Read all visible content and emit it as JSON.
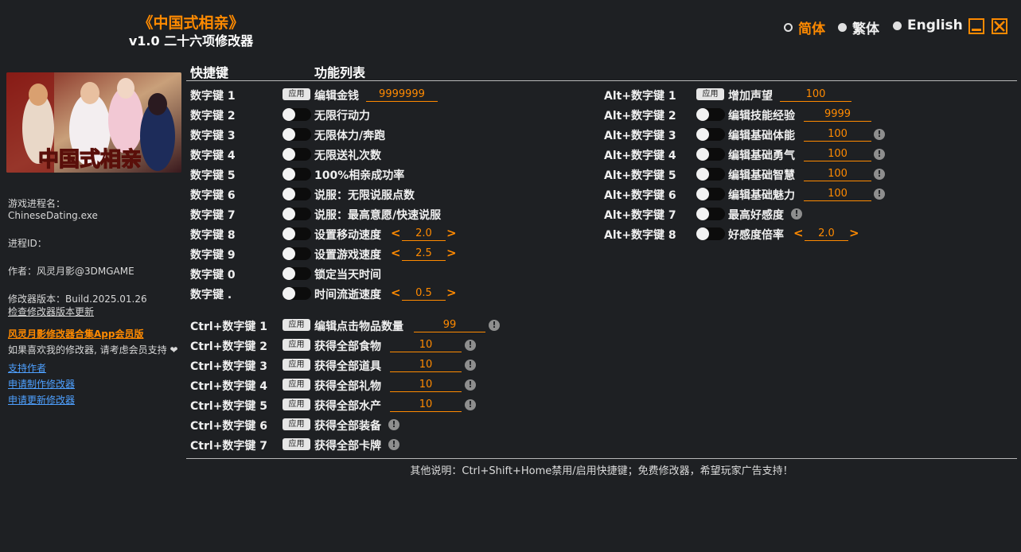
{
  "header": {
    "title": "《中国式相亲》",
    "subtitle": "v1.0 二十六项修改器",
    "languages": [
      "简体",
      "繁体",
      "English"
    ],
    "active_language": "简体"
  },
  "sidebar": {
    "cover_title": "中国式相亲",
    "process_label": "游戏进程名：",
    "process_name": "ChineseDating.exe",
    "pid_label": "进程ID：",
    "author": "作者：风灵月影@3DMGAME",
    "version": "修改器版本：Build.2025.01.26",
    "check_update": "检查修改器版本更新",
    "app_link": "风灵月影修改器合集App会员版",
    "support_text": "如果喜欢我的修改器, 请考虑会员支持",
    "links": [
      "支持作者",
      "申请制作修改器",
      "申请更新修改器"
    ]
  },
  "columns": {
    "hotkey": "快捷键",
    "features": "功能列表"
  },
  "apply_label": "应用",
  "left_rows": [
    {
      "key": "数字键 1",
      "label": "编辑金钱",
      "value": "9999999"
    },
    {
      "key": "数字键 2",
      "label": "无限行动力"
    },
    {
      "key": "数字键 3",
      "label": "无限体力/奔跑"
    },
    {
      "key": "数字键 4",
      "label": "无限送礼次数"
    },
    {
      "key": "数字键 5",
      "label": "100%相亲成功率"
    },
    {
      "key": "数字键 6",
      "label": "说服：无限说服点数"
    },
    {
      "key": "数字键 7",
      "label": "说服：最高意愿/快速说服"
    },
    {
      "key": "数字键 8",
      "label": "设置移动速度",
      "value": "2.0"
    },
    {
      "key": "数字键 9",
      "label": "设置游戏速度",
      "value": "2.5"
    },
    {
      "key": "数字键 0",
      "label": "锁定当天时间"
    },
    {
      "key": "数字键 .",
      "label": "时间流逝速度",
      "value": "0.5"
    }
  ],
  "ctrl_rows": [
    {
      "key": "Ctrl+数字键 1",
      "label": "编辑点击物品数量",
      "value": "99"
    },
    {
      "key": "Ctrl+数字键 2",
      "label": "获得全部食物",
      "value": "10"
    },
    {
      "key": "Ctrl+数字键 3",
      "label": "获得全部道具",
      "value": "10"
    },
    {
      "key": "Ctrl+数字键 4",
      "label": "获得全部礼物",
      "value": "10"
    },
    {
      "key": "Ctrl+数字键 5",
      "label": "获得全部水产",
      "value": "10"
    },
    {
      "key": "Ctrl+数字键 6",
      "label": "获得全部装备"
    },
    {
      "key": "Ctrl+数字键 7",
      "label": "获得全部卡牌"
    }
  ],
  "alt_rows": [
    {
      "key": "Alt+数字键 1",
      "label": "增加声望",
      "value": "100"
    },
    {
      "key": "Alt+数字键 2",
      "label": "编辑技能经验",
      "value": "9999"
    },
    {
      "key": "Alt+数字键 3",
      "label": "编辑基础体能",
      "value": "100"
    },
    {
      "key": "Alt+数字键 4",
      "label": "编辑基础勇气",
      "value": "100"
    },
    {
      "key": "Alt+数字键 5",
      "label": "编辑基础智慧",
      "value": "100"
    },
    {
      "key": "Alt+数字键 6",
      "label": "编辑基础魅力",
      "value": "100"
    },
    {
      "key": "Alt+数字键 7",
      "label": "最高好感度"
    },
    {
      "key": "Alt+数字键 8",
      "label": "好感度倍率",
      "value": "2.0"
    }
  ],
  "footer": "其他说明：Ctrl+Shift+Home禁用/启用快捷键；免费修改器，希望玩家广告支持！",
  "colors": {
    "accent": "#ff8a00",
    "background": "#1e2023",
    "link": "#4ea0ff"
  }
}
